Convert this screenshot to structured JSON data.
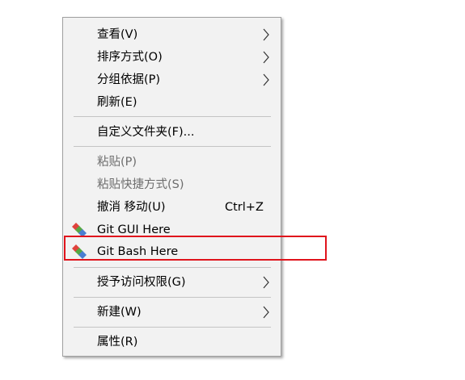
{
  "menu": {
    "items": [
      {
        "label": "查看(V)",
        "submenu": true,
        "disabled": false
      },
      {
        "label": "排序方式(O)",
        "submenu": true,
        "disabled": false
      },
      {
        "label": "分组依据(P)",
        "submenu": true,
        "disabled": false
      },
      {
        "label": "刷新(E)",
        "submenu": false,
        "disabled": false
      },
      {
        "label": "自定义文件夹(F)...",
        "submenu": false,
        "disabled": false
      },
      {
        "label": "粘贴(P)",
        "submenu": false,
        "disabled": true
      },
      {
        "label": "粘贴快捷方式(S)",
        "submenu": false,
        "disabled": true
      },
      {
        "label": "撤消 移动(U)",
        "shortcut": "Ctrl+Z",
        "submenu": false,
        "disabled": false
      },
      {
        "label": "Git GUI Here",
        "icon": "git-icon",
        "submenu": false,
        "disabled": false
      },
      {
        "label": "Git Bash Here",
        "icon": "git-icon",
        "submenu": false,
        "disabled": false,
        "highlighted": true
      },
      {
        "label": "授予访问权限(G)",
        "submenu": true,
        "disabled": false
      },
      {
        "label": "新建(W)",
        "submenu": true,
        "disabled": false
      },
      {
        "label": "属性(R)",
        "submenu": false,
        "disabled": false
      }
    ]
  },
  "colors": {
    "menu_background": "#f2f2f2",
    "highlight_border": "#e0141c",
    "disabled_text": "#6d6d6d"
  }
}
